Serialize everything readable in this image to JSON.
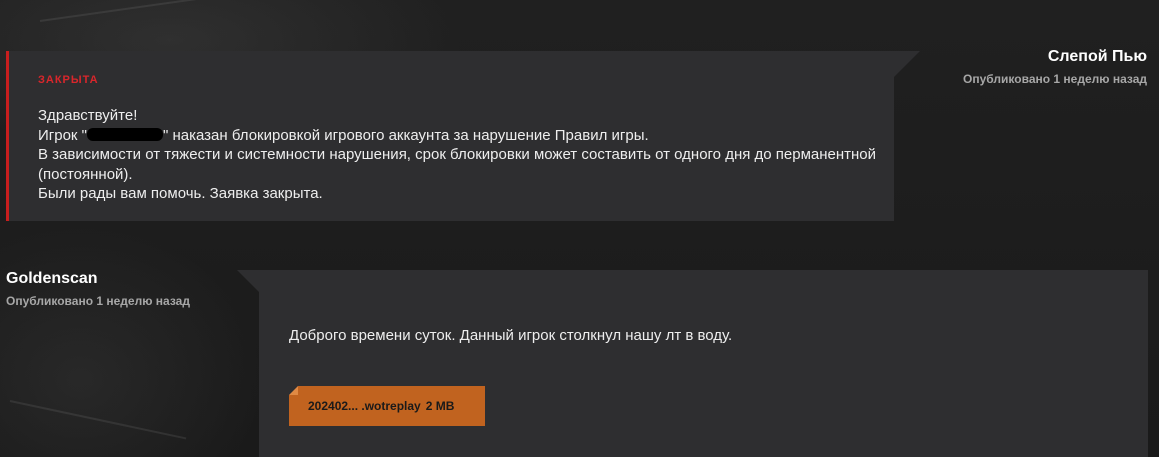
{
  "support_reply": {
    "status": "ЗАКРЫТА",
    "lines": [
      "Здравствуйте!",
      "Игрок \"",
      "\" наказан блокировкой игрового аккаунта за нарушение Правил игры.",
      "В зависимости от тяжести и системности нарушения, срок блокировки может составить от одного дня до перманентной (постоянной).",
      "Были рады вам помочь. Заявка закрыта."
    ],
    "author": "Слепой Пью",
    "posted": "Опубликовано 1 неделю назад"
  },
  "user_message": {
    "author": "Goldenscan",
    "posted": "Опубликовано 1 неделю назад",
    "text": "Доброго времени суток. Данный игрок столкнул нашу лт в воду.",
    "attachment": {
      "name": "202402... .wotreplay",
      "size": "2 MB"
    }
  },
  "colors": {
    "closed_status": "#d9262b",
    "card_background": "#2e2e30",
    "attachment_background": "#c1631f"
  }
}
